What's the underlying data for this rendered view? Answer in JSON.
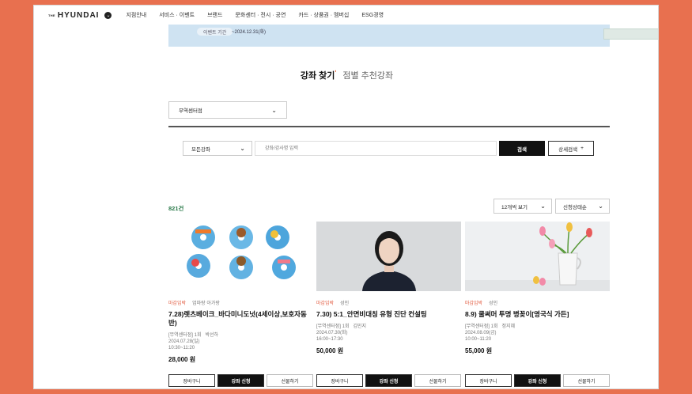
{
  "header": {
    "logo_the": "THE",
    "logo_brand": "HYUNDAI",
    "nav": [
      "지점안내",
      "서비스 · 이벤트",
      "브랜드",
      "문화센터 · 전시 · 공연",
      "카드 · 상품권 · 멤버십",
      "ESG경영"
    ]
  },
  "banner": {
    "pill": "이벤트 기간",
    "date": "~2024.12.31(화)"
  },
  "tabs": {
    "active": "강좌 찾기",
    "other": "점별 추천강좌"
  },
  "store_select": {
    "value": "무역센터점"
  },
  "search": {
    "category": "모든강좌",
    "placeholder": "강좌/강사명 입력",
    "search_label": "검색",
    "detail_label": "상세검색",
    "detail_icon": "+"
  },
  "results": {
    "count": "821건",
    "per_page": "12개씩 보기",
    "sort": "신청상태순"
  },
  "cards": [
    {
      "badge": "마감임박",
      "kind": "엄마랑 아가랑",
      "title": "7.28)렛츠베이크_바다미니도넛(4세이상,보호자동반)",
      "store": "[무역센터점] 1회",
      "teacher": "박선하",
      "date": "2024.07.28(일)",
      "time": "10:30~11:20",
      "price": "28,000 원",
      "cart": "장바구니",
      "apply": "강좌 신청",
      "gift": "선물하기"
    },
    {
      "badge": "마감임박",
      "kind": "성인",
      "title": "7.30) 5:1_안면비대칭 유형 진단 컨설팅",
      "store": "[무역센터점] 1회",
      "teacher": "김민지",
      "date": "2024.07.30(화)",
      "time": "16:00~17:30",
      "price": "50,000 원",
      "cart": "장바구니",
      "apply": "강좌 신청",
      "gift": "선물하기"
    },
    {
      "badge": "마감임박",
      "kind": "성인",
      "title": "8.9) 쿨써머 투명 병꽂이[영국식 가든]",
      "store": "[무역센터점] 1회",
      "teacher": "정지혜",
      "date": "2024.08.09(금)",
      "time": "10:00~11:20",
      "price": "55,000 원",
      "cart": "장바구니",
      "apply": "강좌 신청",
      "gift": "선물하기"
    }
  ],
  "colors": {
    "frame": "#e8704f",
    "accent": "#e25a3f",
    "count": "#2a7a4a"
  }
}
